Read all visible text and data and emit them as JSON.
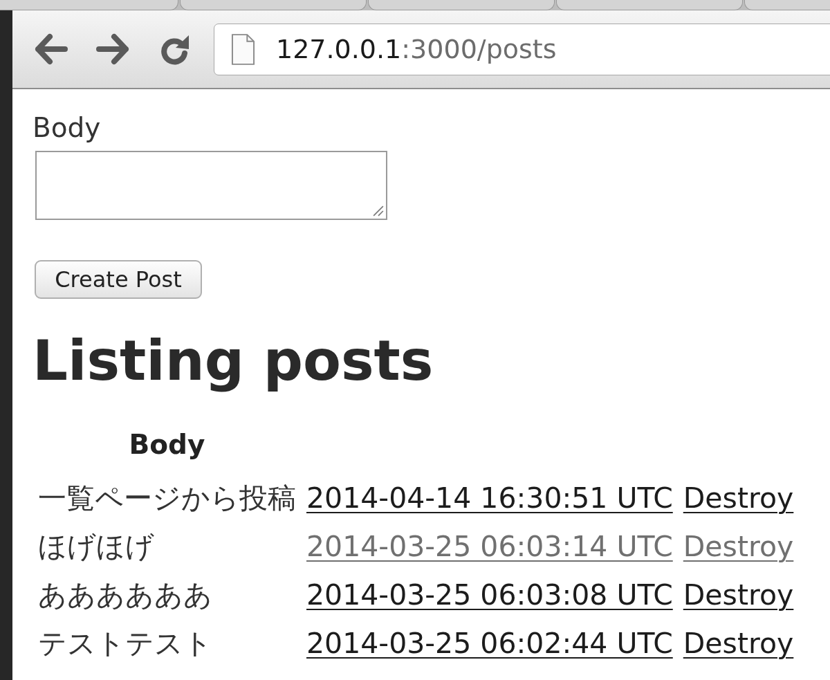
{
  "browser": {
    "tabs": [
      {
        "selected": false
      },
      {
        "selected": false
      },
      {
        "selected": false
      },
      {
        "selected": false
      },
      {
        "selected": false
      }
    ],
    "address": {
      "host": "127.0.0.1",
      "path": ":3000/posts"
    }
  },
  "form": {
    "label": "Body",
    "submit": "Create Post"
  },
  "heading": "Listing posts",
  "table": {
    "columns": [
      "Body"
    ],
    "rows": [
      {
        "body": "一覧ページから投稿",
        "created_at": "2014-04-14 16:30:51 UTC",
        "action": "Destroy",
        "visited": false
      },
      {
        "body": "ほげほげ",
        "created_at": "2014-03-25 06:03:14 UTC",
        "action": "Destroy",
        "visited": true
      },
      {
        "body": "ああああああ",
        "created_at": "2014-03-25 06:03:08 UTC",
        "action": "Destroy",
        "visited": false
      },
      {
        "body": "テストテスト",
        "created_at": "2014-03-25 06:02:44 UTC",
        "action": "Destroy",
        "visited": false
      }
    ]
  }
}
